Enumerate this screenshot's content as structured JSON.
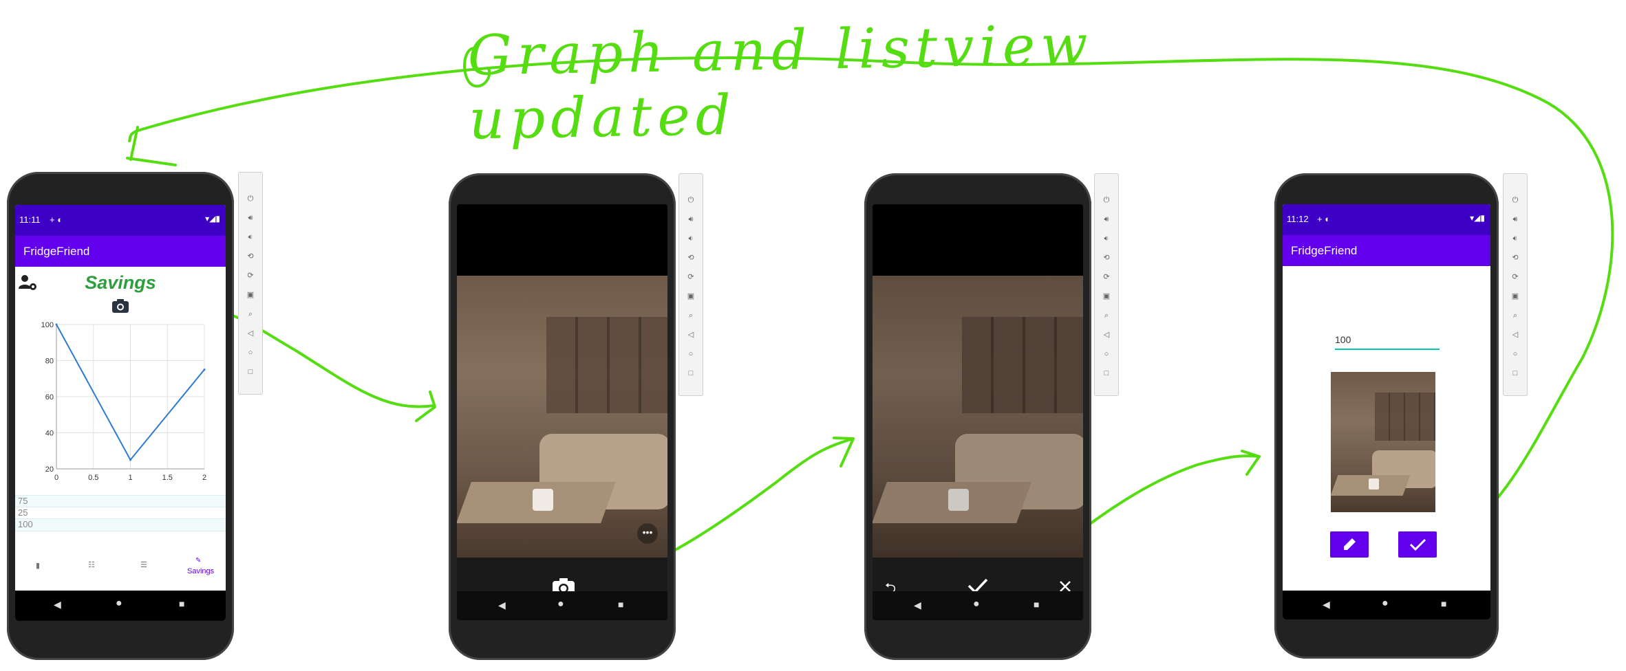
{
  "annotation": {
    "caption": "Graph and listview updated",
    "color": "#55dd11"
  },
  "phone1": {
    "status_time": "11:11",
    "status_extra": "+ ◐",
    "app_title": "FridgeFriend",
    "page_title": "Savings",
    "chart_data": {
      "type": "line",
      "x": [
        0,
        1,
        2
      ],
      "y": [
        100,
        25,
        75
      ],
      "xlim": [
        0,
        2
      ],
      "ylim": [
        20,
        100
      ],
      "x_ticks": [
        "0",
        "0.5",
        "1",
        "1.5",
        "2"
      ],
      "y_ticks": [
        "100",
        "80",
        "60",
        "40",
        "20"
      ],
      "grid": true,
      "line_color": "#2b7bd0"
    },
    "list_items": [
      "75",
      "25",
      "100"
    ],
    "bottom_nav": {
      "active_label": "Savings"
    },
    "icons": {
      "profile": "user-settings-icon",
      "camera": "camera-icon"
    }
  },
  "phone2": {
    "icons": {
      "shutter": "camera-icon",
      "more": "more-icon"
    }
  },
  "phone3": {
    "icons": {
      "retake": "undo-icon",
      "confirm": "check-icon",
      "cancel": "close-icon"
    }
  },
  "phone4": {
    "status_time": "11:12",
    "status_extra": "+ ◐",
    "app_title": "FridgeFriend",
    "amount_value": "100",
    "icons": {
      "edit": "pencil-icon",
      "confirm": "check-icon"
    }
  },
  "colors": {
    "app_bar": "#6200ee",
    "status_bar": "#3d00c4",
    "savings_title": "#2e9e3e",
    "teal_underline": "#00c8b4"
  }
}
